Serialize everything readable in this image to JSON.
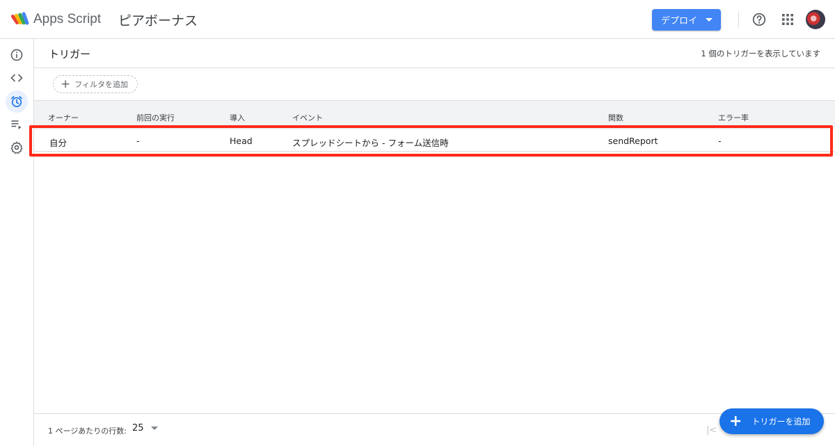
{
  "header": {
    "app_name": "Apps Script",
    "project_name": "ピアボーナス",
    "deploy_label": "デプロイ",
    "icons": [
      "apps-script-logo",
      "help-icon",
      "apps-grid-icon",
      "avatar"
    ]
  },
  "sidebar": {
    "items": [
      {
        "name": "overview",
        "icon": "info-icon",
        "active": false
      },
      {
        "name": "editor",
        "icon": "code-icon",
        "active": false
      },
      {
        "name": "triggers",
        "icon": "alarm-clock-icon",
        "active": true
      },
      {
        "name": "executions",
        "icon": "list-play-icon",
        "active": false
      },
      {
        "name": "settings",
        "icon": "gear-icon",
        "active": false
      }
    ]
  },
  "main": {
    "title": "トリガー",
    "count_text": "1 個のトリガーを表示しています",
    "filter_label": "フィルタを追加",
    "table": {
      "columns": [
        "オーナー",
        "前回の実行",
        "導入",
        "イベント",
        "関数",
        "エラー率"
      ],
      "rows": [
        [
          "自分",
          "-",
          "Head",
          "スプレッドシートから - フォーム送信時",
          "sendReport",
          "-"
        ]
      ]
    },
    "footer": {
      "rows_per_page_label": "1 ページあたりの行数:",
      "rows_per_page_value": "25",
      "first_page_symbol": "|<"
    },
    "add_trigger_label": "トリガーを追加"
  },
  "colors": {
    "primary": "#4285f4",
    "fab": "#1a73e8",
    "highlight": "#ff2a1a",
    "active_nav": "#e8f0fe",
    "active_icon": "#1a73e8"
  }
}
